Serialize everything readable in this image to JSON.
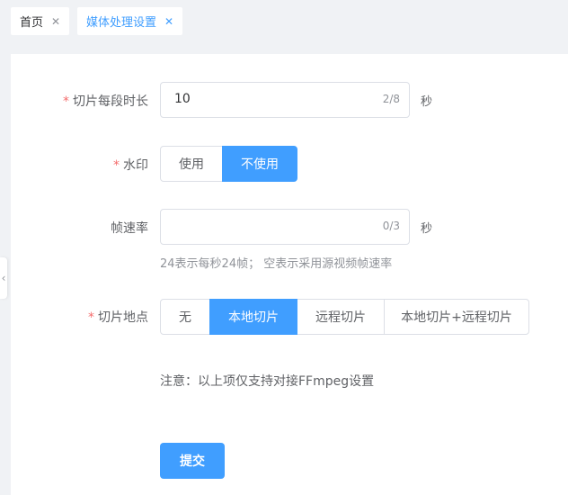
{
  "tabs": [
    {
      "label": "首页",
      "close": "✕"
    },
    {
      "label": "媒体处理设置",
      "close": "✕"
    }
  ],
  "collapse_icon": "chevron-left-icon",
  "form": {
    "required_mark": "*",
    "segment_duration": {
      "label": "切片每段时长",
      "value": "10",
      "count": "2/8",
      "unit": "秒"
    },
    "watermark": {
      "label": "水印",
      "options": [
        "使用",
        "不使用"
      ],
      "selected": "不使用"
    },
    "frame_rate": {
      "label": "帧速率",
      "value": "",
      "count": "0/3",
      "unit": "秒",
      "hint": "24表示每秒24帧； 空表示采用源视频帧速率"
    },
    "slice_location": {
      "label": "切片地点",
      "options": [
        "无",
        "本地切片",
        "远程切片",
        "本地切片+远程切片"
      ],
      "selected": "本地切片"
    },
    "note": "注意：以上项仅支持对接FFmpeg设置",
    "submit_label": "提交"
  },
  "colors": {
    "primary": "#409eff",
    "required": "#f56c6c",
    "border": "#dcdfe6"
  }
}
